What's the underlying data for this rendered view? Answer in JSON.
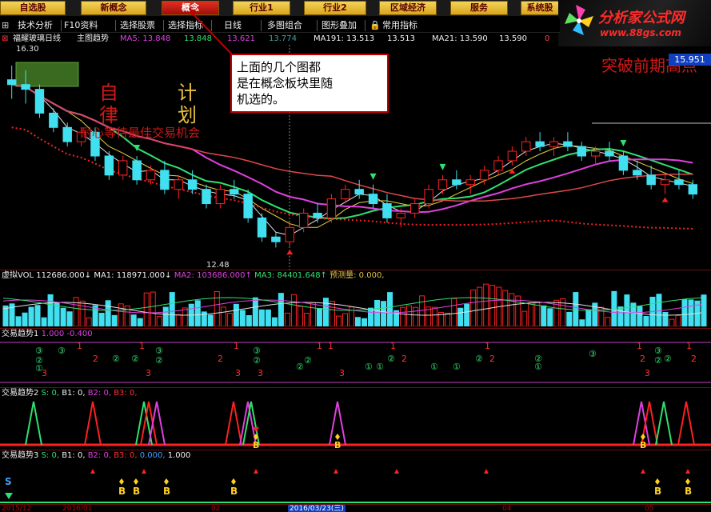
{
  "nav": {
    "buttons": [
      "自选股",
      "新概念",
      "概念",
      "行业1",
      "行业2",
      "区域经济",
      "服务",
      "系统股"
    ],
    "active_index": 2
  },
  "brand": {
    "title": "分析家公式网",
    "url": "www.88gs.com"
  },
  "toolbar": {
    "items": [
      "技术分析",
      "F10资料",
      "选择股票",
      "选择指标",
      "日线",
      "多图组合",
      "图形叠加",
      "常用指标"
    ]
  },
  "main_panel": {
    "stock": "福耀玻璃日线",
    "view": "主图趋势",
    "ma5": "MA5: 13.848",
    "ma5b": "13.848",
    "ma5c": "13.621",
    "ma5d": "13.774",
    "ma191": "MA191: 13.513",
    "ma191b": "13.513",
    "ma21": "MA21: 13.590",
    "ma21b": "13.590",
    "ma_last": "0",
    "price_label": "15.951",
    "high": "16.30",
    "low": "12.48",
    "annotation": "突破前期高点",
    "text_zi": "自",
    "text_lv": "律",
    "text_ji": "计",
    "text_hua": "划",
    "text_wait": "耐心等待最佳交易机会"
  },
  "callout": {
    "line1": "上面的几个图都",
    "line2": "是在概念板块里随",
    "line3": "机选的。"
  },
  "vol_panel": {
    "label": "虚拟VOL",
    "vol": "112686.000↓",
    "ma1": "MA1: 118971.000↓",
    "ma2": "MA2: 103686.000↑",
    "ma3": "MA3: 84401.648↑",
    "predict": "预测量: 0.000,"
  },
  "trend1": {
    "label": "交易趋势1",
    "v1": "1.000",
    "v2": "-0.400"
  },
  "trend2": {
    "label": "交易趋势2",
    "s": "S: 0,",
    "b1": "B1: 0,",
    "b2": "B2: 0,",
    "b3": "B3: 0,",
    "b_marker": "B"
  },
  "trend3": {
    "label": "交易趋势3",
    "s": "S: 0,",
    "b1": "B1: 0,",
    "b2": "B2: 0,",
    "b3": "B3: 0,",
    "v": "0.000,",
    "v2": "1.000",
    "s_marker": "S",
    "b_marker": "B"
  },
  "axis": {
    "dates": [
      "2015/12",
      "2016/01",
      "02",
      "2016/03/23(三)",
      "04",
      "05"
    ]
  },
  "colors": {
    "up": "#ff2020",
    "down": "#40e0f0",
    "ma_green": "#30e070",
    "ma_magenta": "#e040e0",
    "accent_red": "#c00000"
  },
  "chart_data": {
    "type": "candlestick",
    "note_ma": "moving averages estimated",
    "candles": [
      [
        16.0,
        16.3,
        15.6,
        15.9
      ],
      [
        15.9,
        16.2,
        15.5,
        15.8
      ],
      [
        15.8,
        15.9,
        15.2,
        15.3
      ],
      [
        15.3,
        15.4,
        14.9,
        15.0
      ],
      [
        15.0,
        15.1,
        14.6,
        14.7
      ],
      [
        14.7,
        15.0,
        14.6,
        14.9
      ],
      [
        14.9,
        15.0,
        14.3,
        14.4
      ],
      [
        14.4,
        14.5,
        13.9,
        14.0
      ],
      [
        14.0,
        14.4,
        13.9,
        14.3
      ],
      [
        14.3,
        14.4,
        13.8,
        13.9
      ],
      [
        13.9,
        14.2,
        13.8,
        14.1
      ],
      [
        14.1,
        14.3,
        13.6,
        13.7
      ],
      [
        13.7,
        14.0,
        13.5,
        13.9
      ],
      [
        13.9,
        14.1,
        13.6,
        13.7
      ],
      [
        13.7,
        13.8,
        13.3,
        13.4
      ],
      [
        13.4,
        13.8,
        13.3,
        13.7
      ],
      [
        13.7,
        13.9,
        13.5,
        13.6
      ],
      [
        13.6,
        13.7,
        13.0,
        13.1
      ],
      [
        13.1,
        13.2,
        12.6,
        12.7
      ],
      [
        12.7,
        12.8,
        12.48,
        12.6
      ],
      [
        12.6,
        13.0,
        12.5,
        12.9
      ],
      [
        12.9,
        13.3,
        12.8,
        13.2
      ],
      [
        13.2,
        13.4,
        13.0,
        13.1
      ],
      [
        13.1,
        13.6,
        13.0,
        13.5
      ],
      [
        13.5,
        13.8,
        13.4,
        13.7
      ],
      [
        13.7,
        13.9,
        13.5,
        13.6
      ],
      [
        13.6,
        13.8,
        13.3,
        13.4
      ],
      [
        13.4,
        13.6,
        13.0,
        13.1
      ],
      [
        13.1,
        13.3,
        12.9,
        13.2
      ],
      [
        13.2,
        13.5,
        13.1,
        13.4
      ],
      [
        13.4,
        13.8,
        13.3,
        13.7
      ],
      [
        13.7,
        14.0,
        13.6,
        13.9
      ],
      [
        13.9,
        14.1,
        13.7,
        13.8
      ],
      [
        13.8,
        14.0,
        13.6,
        13.9
      ],
      [
        13.9,
        14.2,
        13.8,
        14.1
      ],
      [
        14.1,
        14.4,
        14.0,
        14.3
      ],
      [
        14.3,
        14.6,
        14.2,
        14.5
      ],
      [
        14.5,
        14.8,
        14.4,
        14.7
      ],
      [
        14.7,
        14.9,
        14.5,
        14.6
      ],
      [
        14.6,
        14.8,
        14.4,
        14.7
      ],
      [
        14.7,
        14.9,
        14.5,
        14.6
      ],
      [
        14.6,
        14.7,
        14.3,
        14.4
      ],
      [
        14.4,
        14.6,
        14.2,
        14.5
      ],
      [
        14.5,
        14.7,
        14.3,
        14.4
      ],
      [
        14.4,
        14.5,
        14.0,
        14.1
      ],
      [
        14.1,
        14.3,
        13.9,
        14.0
      ],
      [
        14.0,
        14.2,
        13.7,
        13.8
      ],
      [
        13.8,
        14.0,
        13.6,
        13.9
      ],
      [
        13.9,
        14.1,
        13.7,
        13.8
      ],
      [
        13.8,
        13.9,
        13.5,
        13.6
      ]
    ]
  }
}
